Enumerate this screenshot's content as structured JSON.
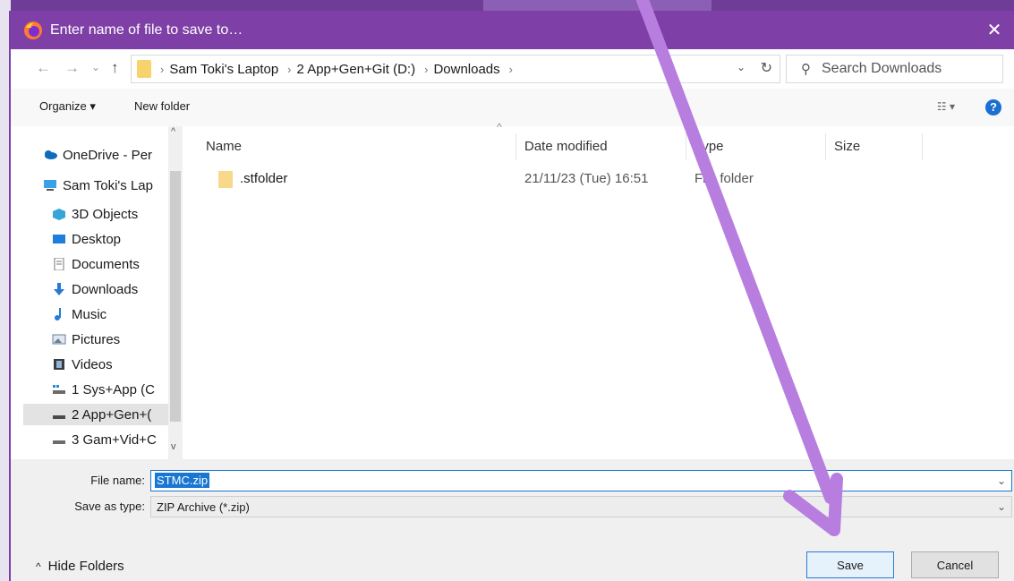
{
  "window": {
    "title": "Enter name of file to save to…",
    "close": "✕"
  },
  "nav": {
    "back": "←",
    "forward": "→",
    "recent": "⌄",
    "up": "↑",
    "breadcrumb": [
      "Sam Toki's Laptop",
      "2 App+Gen+Git (D:)",
      "Downloads"
    ],
    "search_placeholder": "Search Downloads"
  },
  "toolbar": {
    "organize": "Organize ▾",
    "new_folder": "New folder",
    "help": "?"
  },
  "sidebar": {
    "items": [
      {
        "label": "OneDrive - Per",
        "icon": "cloud-icon"
      },
      {
        "label": "Sam Toki's Lap",
        "icon": "computer-icon"
      },
      {
        "label": "3D Objects",
        "icon": "cube-icon"
      },
      {
        "label": "Desktop",
        "icon": "desktop-icon"
      },
      {
        "label": "Documents",
        "icon": "document-icon"
      },
      {
        "label": "Downloads",
        "icon": "download-arrow-icon"
      },
      {
        "label": "Music",
        "icon": "music-note-icon"
      },
      {
        "label": "Pictures",
        "icon": "pictures-icon"
      },
      {
        "label": "Videos",
        "icon": "video-icon"
      },
      {
        "label": "1 Sys+App (C",
        "icon": "drive-icon"
      },
      {
        "label": "2 App+Gen+(",
        "icon": "drive-icon"
      },
      {
        "label": "3 Gam+Vid+C",
        "icon": "drive-icon"
      }
    ]
  },
  "files": {
    "columns": [
      "Name",
      "Date modified",
      "Type",
      "Size"
    ],
    "rows": [
      {
        "name": ".stfolder",
        "date": "21/11/23 (Tue) 16:51",
        "type": "File folder",
        "size": ""
      }
    ]
  },
  "form": {
    "file_name_label": "File name:",
    "file_name_value": "STMC.zip",
    "save_type_label": "Save as type:",
    "save_type_value": "ZIP Archive (*.zip)"
  },
  "footer": {
    "hide_folders": "Hide Folders",
    "save": "Save",
    "cancel": "Cancel"
  },
  "colors": {
    "titlebar": "#7e40a6",
    "accent": "#1976d2",
    "annotation_arrow": "#b77ee0"
  }
}
